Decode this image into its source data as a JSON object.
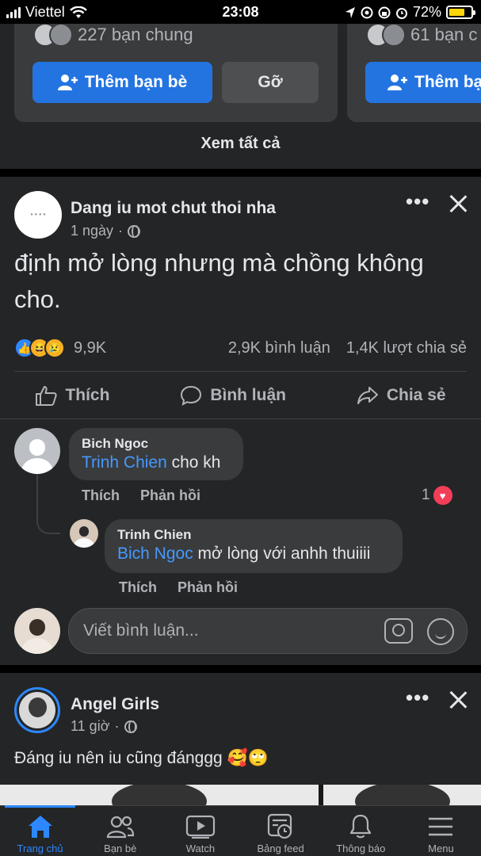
{
  "status_bar": {
    "carrier": "Viettel",
    "time": "23:08",
    "battery": "72%",
    "battery_level": 0.72
  },
  "suggestions": {
    "card1": {
      "mutual": "227 bạn chung",
      "add_label": "Thêm bạn bè",
      "remove_label": "Gỡ"
    },
    "card2": {
      "mutual": "61 bạn c",
      "add_label": "Thêm bạ"
    },
    "see_all": "Xem tất cả"
  },
  "post1": {
    "author": "Dang iu mot chut thoi nha",
    "time": "1 ngày",
    "text": "định mở lòng nhưng mà chồng không cho.",
    "reaction_count": "9,9K",
    "comment_count": "2,9K bình luận",
    "share_count": "1,4K lượt chia sẻ",
    "actions": {
      "like": "Thích",
      "comment": "Bình luận",
      "share": "Chia sẻ"
    },
    "comments": [
      {
        "name": "Bich Ngoc",
        "tag": "Trinh Chien",
        "text": " cho kh",
        "like": "Thích",
        "reply": "Phản hồi",
        "reactions": "1"
      },
      {
        "name": "Trinh Chien",
        "tag": "Bich Ngoc",
        "text": " mở lòng với anhh thuiiii",
        "like": "Thích",
        "reply": "Phản hồi"
      }
    ],
    "write_placeholder": "Viết bình luận..."
  },
  "post2": {
    "author": "Angel Girls",
    "time": "11 giờ",
    "text": "Đáng iu nên iu cũng đánggg 🥰🙄"
  },
  "tabbar": [
    {
      "label": "Trang chủ",
      "icon": "home-icon"
    },
    {
      "label": "Bạn bè",
      "icon": "friends-icon"
    },
    {
      "label": "Watch",
      "icon": "watch-icon"
    },
    {
      "label": "Bảng feed",
      "icon": "feeds-icon"
    },
    {
      "label": "Thông báo",
      "icon": "bell-icon"
    },
    {
      "label": "Menu",
      "icon": "menu-icon"
    }
  ],
  "colors": {
    "accent": "#2374e1",
    "link": "#4599ff",
    "background": "#18191a",
    "card": "#242526"
  }
}
